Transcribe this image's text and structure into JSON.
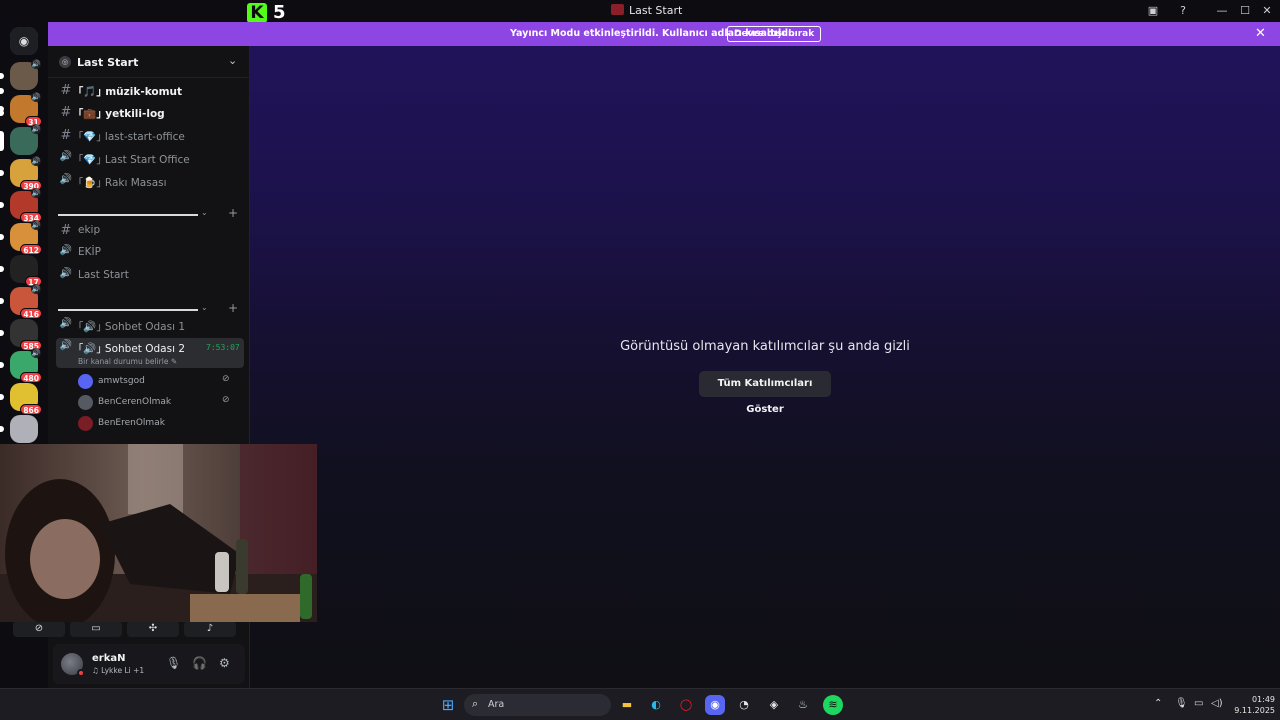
{
  "window": {
    "title": "Last Start",
    "kick_badge": "5"
  },
  "banner": {
    "message": "Yayıncı Modu etkinleştirildi. Kullanıcı adları kısaltıldı.",
    "button": "Devre dışı bırak"
  },
  "servers": [
    {
      "badge": ""
    },
    {
      "badge": "31"
    },
    {
      "badge": ""
    },
    {
      "badge": "390"
    },
    {
      "badge": "334"
    },
    {
      "badge": "612"
    },
    {
      "badge": "17"
    },
    {
      "badge": "416"
    },
    {
      "badge": "585"
    },
    {
      "badge": "480"
    },
    {
      "badge": "866"
    },
    {
      "badge": ""
    }
  ],
  "server": {
    "name": "Last Start"
  },
  "channels": [
    {
      "type": "text",
      "label": "｢🎵｣ müzik-komut",
      "unread": true
    },
    {
      "type": "text",
      "label": "｢💼｣ yetkili-log",
      "unread": true
    },
    {
      "type": "text",
      "label": "｢💎｣ last-start-office",
      "unread": false
    },
    {
      "type": "voice",
      "label": "｢💎｣ Last Start Office",
      "unread": false
    },
    {
      "type": "voice",
      "label": "｢🍺｣ Rakı Masası",
      "unread": false
    }
  ],
  "channels2": [
    {
      "type": "text",
      "label": "ekip"
    },
    {
      "type": "voice",
      "label": "EKİP"
    },
    {
      "type": "voice",
      "label": "Last Start"
    }
  ],
  "voice_channels": [
    {
      "label": "｢🔊｣ Sohbet Odası 1"
    },
    {
      "label": "｢🔊｣ Sohbet Odası 2",
      "time": "7:53:07",
      "status": "Bir kanal durumu belirle ✎"
    }
  ],
  "voice_users": [
    {
      "name": "amwtsgod"
    },
    {
      "name": "BenCerenOlmak"
    },
    {
      "name": "BenErenOlmak"
    }
  ],
  "user": {
    "name": "erkaN",
    "status": "♫ Lykke Li +1"
  },
  "main": {
    "message": "Görüntüsü olmayan katılımcılar şu anda gizli",
    "button": "Tüm Katılımcıları Göster"
  },
  "taskbar": {
    "search": "Ara",
    "time": "01:49",
    "date": "9.11.2025"
  },
  "colors": {
    "accent": "#8d45e3",
    "kick": "#53fc18",
    "badge": "#f23f43",
    "voice_active": "#23a55a"
  }
}
